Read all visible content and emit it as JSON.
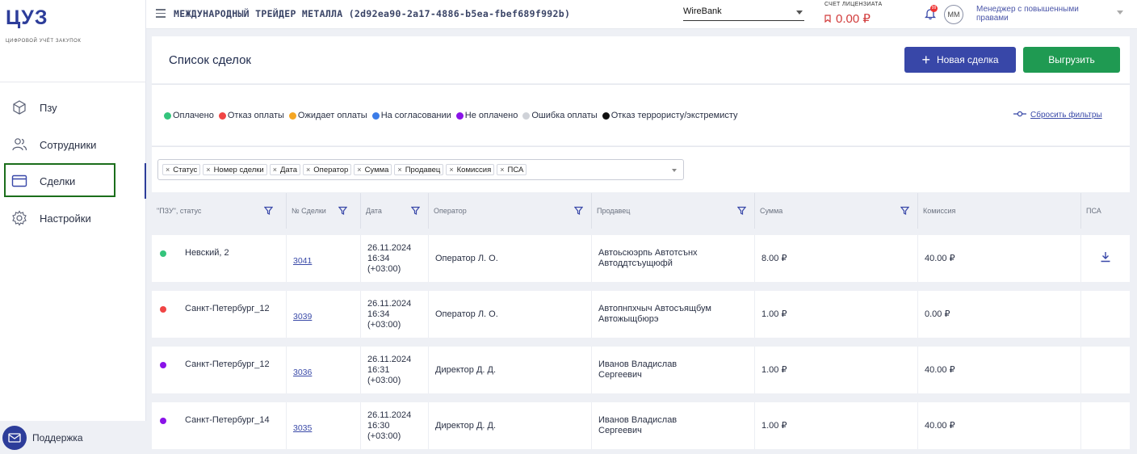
{
  "sidebar": {
    "logo": "ЦУЗ",
    "logo_sub": "ЦИФРОВОЙ УЧЁТ ЗАКУПОК",
    "items": [
      {
        "label": "Пзу",
        "icon": "cube-icon"
      },
      {
        "label": "Сотрудники",
        "icon": "users-icon"
      },
      {
        "label": "Сделки",
        "icon": "card-icon",
        "active": true
      },
      {
        "label": "Настройки",
        "icon": "gear-icon"
      }
    ],
    "support": "Поддержка"
  },
  "topbar": {
    "company": "МЕЖДУНАРОДНЫЙ ТРЕЙДЕР МЕТАЛЛА (2d92ea90-2a17-4886-b5ea-fbef689f992b)",
    "bank": "WireBank",
    "account_label": "СЧЕТ ЛИЦЕНЗИАТА",
    "account_value": "0.00 ₽",
    "notif_count": "99",
    "avatar": "ММ",
    "role": "Менеджер с повышенными правами"
  },
  "page": {
    "title": "Список сделок",
    "new_button": "Новая сделка",
    "export_button": "Выгрузить",
    "reset_filters": "Сбросить фильтры"
  },
  "legend": [
    {
      "label": "Оплачено",
      "color": "#34c47c"
    },
    {
      "label": "Отказ оплаты",
      "color": "#f04545"
    },
    {
      "label": "Ожидает оплаты",
      "color": "#f5a623"
    },
    {
      "label": "На согласовании",
      "color": "#3b7ce8"
    },
    {
      "label": "Не оплачено",
      "color": "#8a13e8"
    },
    {
      "label": "Ошибка оплаты",
      "color": "#cfd2d8"
    },
    {
      "label": "Отказ террористу/экстремисту",
      "color": "#111111"
    }
  ],
  "columns_filter": [
    "Статус",
    "Номер сделки",
    "Дата",
    "Оператор",
    "Сумма",
    "Продавец",
    "Комиссия",
    "ПСА"
  ],
  "table": {
    "headers": [
      "\"ПЗУ\", статус",
      "№ Сделки",
      "Дата",
      "Оператор",
      "Продавец",
      "Сумма",
      "Комиссия",
      "ПСА"
    ],
    "rows": [
      {
        "status_color": "#34c47c",
        "pzu": "Невский, 2",
        "deal": "3041",
        "date1": "26.11.2024",
        "date2": "16:34",
        "date3": "(+03:00)",
        "operator": "Оператор Л. О.",
        "seller": "Автоьсюэрпь Автотсънх Автоддтсъущюфй",
        "sum": "8.00 ₽",
        "commission": "40.00 ₽",
        "psa": true
      },
      {
        "status_color": "#f04545",
        "pzu": "Санкт-Петербург_12",
        "deal": "3039",
        "date1": "26.11.2024",
        "date2": "16:34",
        "date3": "(+03:00)",
        "operator": "Оператор Л. О.",
        "seller": "Автопнпхчыч Автосъящбум Автожыщбюрэ",
        "sum": "1.00 ₽",
        "commission": "0.00 ₽",
        "psa": false
      },
      {
        "status_color": "#8a13e8",
        "pzu": "Санкт-Петербург_12",
        "deal": "3036",
        "date1": "26.11.2024",
        "date2": "16:31",
        "date3": "(+03:00)",
        "operator": "Директор Д. Д.",
        "seller": "Иванов Владислав Сергеевич",
        "sum": "1.00 ₽",
        "commission": "40.00 ₽",
        "psa": false
      },
      {
        "status_color": "#8a13e8",
        "pzu": "Санкт-Петербург_14",
        "deal": "3035",
        "date1": "26.11.2024",
        "date2": "16:30",
        "date3": "(+03:00)",
        "operator": "Директор Д. Д.",
        "seller": "Иванов Владислав Сергеевич",
        "sum": "1.00 ₽",
        "commission": "40.00 ₽",
        "psa": false
      }
    ]
  }
}
